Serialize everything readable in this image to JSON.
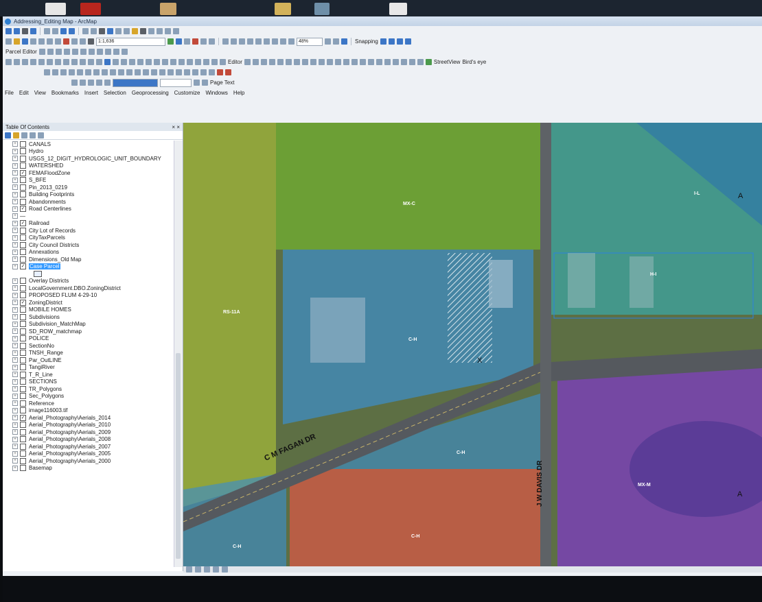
{
  "window": {
    "title": "Addressing_Editing Map - ArcMap"
  },
  "toolbar": {
    "scale": "1:1,636",
    "parcel_editor": "Parcel Editor",
    "snapping": "Snapping",
    "editor": "Editor",
    "zoom_percent": "48%",
    "street_view": "StreetView",
    "birds_eye": "Bird's eye",
    "page_text": "Page Text"
  },
  "menu": [
    "File",
    "Edit",
    "View",
    "Bookmarks",
    "Insert",
    "Selection",
    "Geoprocessing",
    "Customize",
    "Windows",
    "Help"
  ],
  "toc": {
    "title": "Table Of Contents",
    "close": "× ×",
    "layers": [
      {
        "name": "CANALS",
        "checked": false
      },
      {
        "name": "Hydro",
        "checked": false
      },
      {
        "name": "USGS_12_DIGIT_HYDROLOGIC_UNIT_BOUNDARY",
        "checked": false
      },
      {
        "name": "WATERSHED",
        "checked": false
      },
      {
        "name": "FEMAFloodZone",
        "checked": true
      },
      {
        "name": "S_BFE",
        "checked": false
      },
      {
        "name": "Pin_2013_0219",
        "checked": false
      },
      {
        "name": "Building Footprints",
        "checked": false
      },
      {
        "name": "Abandonments",
        "checked": false
      },
      {
        "name": "Road Centerlines",
        "checked": true
      },
      {
        "name": "—",
        "checked": null
      },
      {
        "name": "Railroad",
        "checked": true
      },
      {
        "name": "City Lot of Records",
        "checked": false
      },
      {
        "name": "CityTaxParcels",
        "checked": false
      },
      {
        "name": "City Council Districts",
        "checked": false
      },
      {
        "name": "Annexations",
        "checked": false
      },
      {
        "name": "Dimensions_Old Map",
        "checked": false
      },
      {
        "name": "Case Parcel",
        "checked": true,
        "selected": true
      },
      {
        "name": "",
        "checked": null,
        "legend": true
      },
      {
        "name": "Overlay Districts",
        "checked": false
      },
      {
        "name": "LocalGovernment.DBO.ZoningDistrict",
        "checked": false
      },
      {
        "name": "PROPOSED FLUM 4-29-10",
        "checked": false
      },
      {
        "name": "ZoningDistrict",
        "checked": true
      },
      {
        "name": "MOBILE HOMES",
        "checked": false
      },
      {
        "name": "Subdivisions",
        "checked": false
      },
      {
        "name": "Subdivision_MatchMap",
        "checked": false
      },
      {
        "name": "SD_ROW_matchmap",
        "checked": false
      },
      {
        "name": "POLICE",
        "checked": false
      },
      {
        "name": "SectionNo",
        "checked": false
      },
      {
        "name": "TNSH_Range",
        "checked": false
      },
      {
        "name": "Par_OutLINE",
        "checked": false
      },
      {
        "name": "TangiRiver",
        "checked": false
      },
      {
        "name": "T_R_Line",
        "checked": false
      },
      {
        "name": "SECTIONS",
        "checked": false
      },
      {
        "name": "TR_Polygons",
        "checked": false
      },
      {
        "name": "Sec_Polygons",
        "checked": false
      },
      {
        "name": "Reference",
        "checked": false
      },
      {
        "name": "image116003.tif",
        "checked": false
      },
      {
        "name": "Aerial_Photography\\Aerials_2014",
        "checked": true
      },
      {
        "name": "Aerial_Photography\\Aerials_2010",
        "checked": false
      },
      {
        "name": "Aerial_Photography\\Aerials_2009",
        "checked": false
      },
      {
        "name": "Aerial_Photography\\Aerials_2008",
        "checked": false
      },
      {
        "name": "Aerial_Photography\\Aerials_2007",
        "checked": false
      },
      {
        "name": "Aerial_Photography\\Aerials_2005",
        "checked": false
      },
      {
        "name": "Aerial_Photography\\Aerials_2000",
        "checked": false
      },
      {
        "name": "Basemap",
        "checked": false
      }
    ]
  },
  "map": {
    "roads": {
      "main": "C M FAGAN DR",
      "cross": "J W DAVIS DR"
    },
    "zone_labels": {
      "mxc": "MX-C",
      "rs": "RS-11A",
      "ch1": "C-H",
      "ch2": "C-H",
      "ch3": "C-H",
      "ch4": "C-H",
      "il": "I-L",
      "hi": "H-I",
      "mxm": "MX-M"
    },
    "flood_labels": {
      "a1": "A",
      "a2": "A",
      "x": "X"
    },
    "colors": {
      "green": "#6fa832",
      "olive": "#9fb43a",
      "blue": "#3d8ec8",
      "teal": "#3aa8a8",
      "red": "#d25a45",
      "purple": "#7a3fb8"
    }
  }
}
